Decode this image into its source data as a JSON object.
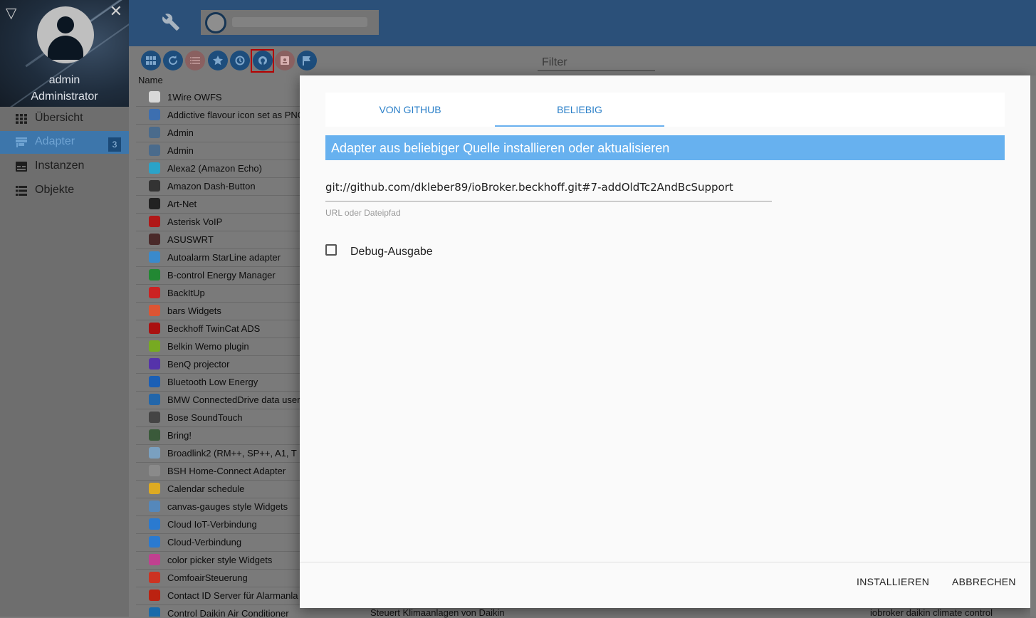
{
  "sidebar": {
    "user_name": "admin",
    "user_role": "Administrator",
    "items": [
      {
        "label": "Übersicht",
        "icon": "grid-icon"
      },
      {
        "label": "Adapter",
        "icon": "store-icon",
        "badge": "3"
      },
      {
        "label": "Instanzen",
        "icon": "instances-icon"
      },
      {
        "label": "Objekte",
        "icon": "list-icon"
      }
    ]
  },
  "toolbar": {
    "filter_placeholder": "Filter"
  },
  "table": {
    "col_name": "Name",
    "rows": [
      {
        "label": "1Wire OWFS",
        "color": "#d8d8d8"
      },
      {
        "label": "Addictive flavour icon set as PNG",
        "color": "#3d6fb0"
      },
      {
        "label": "Admin",
        "color": "#4a6b8c"
      },
      {
        "label": "Admin",
        "color": "#4a6b8c"
      },
      {
        "label": "Alexa2 (Amazon Echo)",
        "color": "#2aa3c9"
      },
      {
        "label": "Amazon Dash-Button",
        "color": "#333333"
      },
      {
        "label": "Art-Net",
        "color": "#222222"
      },
      {
        "label": "Asterisk VoIP",
        "color": "#b01818"
      },
      {
        "label": "ASUSWRT",
        "color": "#4a2a2a"
      },
      {
        "label": "Autoalarm StarLine adapter",
        "color": "#3a8acc"
      },
      {
        "label": "B-control Energy Manager",
        "color": "#228833"
      },
      {
        "label": "BackItUp",
        "color": "#cc2222"
      },
      {
        "label": "bars Widgets",
        "color": "#dd5533"
      },
      {
        "label": "Beckhoff TwinCat ADS",
        "color": "#aa1111"
      },
      {
        "label": "Belkin Wemo plugin",
        "color": "#77aa22"
      },
      {
        "label": "BenQ projector",
        "color": "#5533aa"
      },
      {
        "label": "Bluetooth Low Energy",
        "color": "#1b5fb5"
      },
      {
        "label": "BMW ConnectedDrive data user",
        "color": "#2266aa"
      },
      {
        "label": "Bose SoundTouch",
        "color": "#444444"
      },
      {
        "label": "Bring!",
        "color": "#3a5a3a"
      },
      {
        "label": "Broadlink2 (RM++, SP++, A1, T",
        "color": "#7aa0c0"
      },
      {
        "label": "BSH Home-Connect Adapter",
        "color": "#8a8a8a"
      },
      {
        "label": "Calendar schedule",
        "color": "#ddaa22"
      },
      {
        "label": "canvas-gauges style Widgets",
        "color": "#5588bb"
      },
      {
        "label": "Cloud IoT-Verbindung",
        "color": "#2a7ad0"
      },
      {
        "label": "Cloud-Verbindung",
        "color": "#2a7ad0"
      },
      {
        "label": "color picker style Widgets",
        "color": "#c04090"
      },
      {
        "label": "ComfoairSteuerung",
        "color": "#cc3322"
      },
      {
        "label": "Contact ID Server für Alarmanla",
        "color": "#bb2211"
      },
      {
        "label": "Control Daikin Air Conditioner",
        "color": "#1a6aaa"
      }
    ],
    "bottom_desc": "Steuert Klimaanlagen von Daikin",
    "bottom_keys": "iobroker daikin climate control"
  },
  "dialog": {
    "tabs": [
      "VON GITHUB",
      "BELIEBIG"
    ],
    "active_tab": "BELIEBIG",
    "banner": "Adapter aus beliebiger Quelle installieren oder aktualisieren",
    "url_value": "git://github.com/dkleber89/ioBroker.beckhoff.git#7-addOldTc2AndBcSupport",
    "url_label": "URL oder Dateipfad",
    "debug_label": "Debug-Ausgabe",
    "debug_checked": false,
    "install_label": "INSTALLIEREN",
    "cancel_label": "ABBRECHEN"
  },
  "colors": {
    "topbar": "#2b5079",
    "accent": "#67b1ef",
    "tab_text": "#2a7fc8",
    "toolbar_button": "#1d4d7c",
    "highlight": "#b40000"
  }
}
